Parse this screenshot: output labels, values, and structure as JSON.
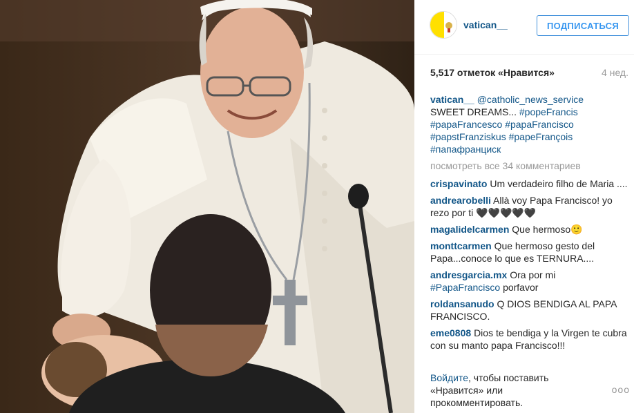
{
  "post": {
    "photo_alt": "Pope Francis blessing a baby"
  },
  "header": {
    "username": "vatican__",
    "follow_label": "ПОДПИСАТЬСЯ"
  },
  "stats": {
    "likes": "5,517 отметок «Нравится»",
    "age": "4 нед."
  },
  "caption": {
    "user": "vatican__",
    "mention": "@catholic_news_service",
    "text": "SWEET DREAMS...",
    "tags": [
      "#popeFrancis",
      "#papaFrancesco",
      "#papaFrancisco",
      "#papstFranziskus",
      "#papeFrançois",
      "#папафранциск"
    ]
  },
  "view_all": "посмотреть все 34 комментариев",
  "comments": [
    {
      "user": "crispavinato",
      "text": "Um verdadeiro filho de Maria ...."
    },
    {
      "user": "andrearobelli",
      "text": "Allà voy Papa Francisco! yo rezo por ti 🖤🖤🖤🖤🖤"
    },
    {
      "user": "magalidelcarmen",
      "text": "Que hermoso🙂"
    },
    {
      "user": "monttcarmen",
      "text": "Que hermoso gesto del Papa...conoce lo que es TERNURA...."
    },
    {
      "user": "andresgarcia.mx",
      "text_pre": "Ora por mi",
      "tag": "#PapaFrancisco",
      "text_post": "porfavor"
    },
    {
      "user": "roldansanudo",
      "text": "Q DIOS BENDIGA AL PAPA FRANCISCO."
    },
    {
      "user": "eme0808",
      "text": "Dios te bendiga y la Virgen te cubra con su manto papa Francisco!!!"
    }
  ],
  "login_prompt": {
    "link": "Войдите",
    "rest": ", чтобы поставить «Нравится» или прокомментировать."
  },
  "more_options": "ooo"
}
